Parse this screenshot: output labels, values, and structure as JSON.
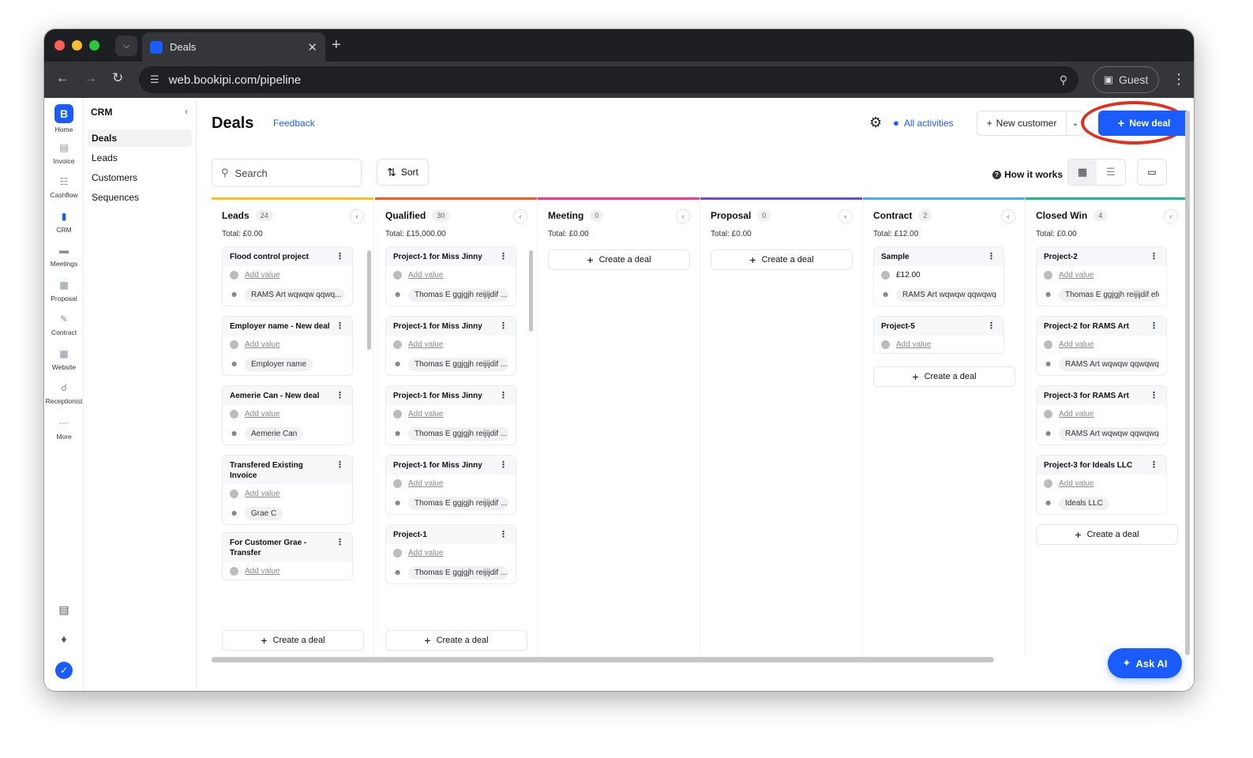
{
  "browser": {
    "tab_title": "Deals",
    "url": "web.bookipi.com/pipeline",
    "profile": "Guest"
  },
  "rail": {
    "logo_letter": "B",
    "items": [
      "Home",
      "Invoice",
      "Cashflow",
      "CRM",
      "Meetings",
      "Proposal",
      "Contract",
      "Website",
      "Receptionist",
      "More"
    ]
  },
  "subnav": {
    "title": "CRM",
    "items": [
      "Deals",
      "Leads",
      "Customers",
      "Sequences"
    ]
  },
  "header": {
    "title": "Deals",
    "feedback": "Feedback",
    "all_activities": "All activities",
    "new_customer": "New customer",
    "new_deal": "New deal"
  },
  "toolbar": {
    "search_placeholder": "Search",
    "sort": "Sort",
    "how_it_works": "How it works"
  },
  "columns": [
    {
      "name": "Leads",
      "count": "24",
      "total": "Total: £0.00",
      "color": "#f2c418",
      "cards": [
        {
          "title": "Flood control project",
          "value": "Add value",
          "person": "RAMS Art wqwqw qqwq..."
        },
        {
          "title": "Employer name - New deal",
          "value": "Add value",
          "person": "Employer name"
        },
        {
          "title": "Aemerie Can - New deal",
          "value": "Add value",
          "person": "Aemerie Can"
        },
        {
          "title": "Transfered Existing Invoice",
          "value": "Add value",
          "person": "Grae C"
        },
        {
          "title": "For Customer Grae - Transfer",
          "value": "Add value",
          "person": ""
        }
      ],
      "create": "Create a deal"
    },
    {
      "name": "Qualified",
      "count": "30",
      "total": "Total: £15,000.00",
      "color": "#ee5c1e",
      "cards": [
        {
          "title": "Project-1 for Miss Jinny",
          "value": "Add value",
          "person": "Thomas E ggjgjh reijijdif ..."
        },
        {
          "title": "Project-1 for Miss Jinny",
          "value": "Add value",
          "person": "Thomas E ggjgjh reijijdif ..."
        },
        {
          "title": "Project-1 for Miss Jinny",
          "value": "Add value",
          "person": "Thomas E ggjgjh reijijdif ..."
        },
        {
          "title": "Project-1 for Miss Jinny",
          "value": "Add value",
          "person": "Thomas E ggjgjh reijijdif ..."
        },
        {
          "title": "Project-1",
          "value": "Add value",
          "person": "Thomas E ggjgjh reijijdif ..."
        }
      ],
      "create": "Create a deal"
    },
    {
      "name": "Meeting",
      "count": "0",
      "total": "Total: £0.00",
      "color": "#e83c8e",
      "cards": [],
      "create": "Create a deal"
    },
    {
      "name": "Proposal",
      "count": "0",
      "total": "Total: £0.00",
      "color": "#6a4cd8",
      "cards": [],
      "create": "Create a deal"
    },
    {
      "name": "Contract",
      "count": "2",
      "total": "Total: £12.00",
      "color": "#56a6ee",
      "cards": [
        {
          "title": "Sample",
          "value": "£12.00",
          "person": "RAMS Art wqwqw qqwqwq ..."
        },
        {
          "title": "Project-5",
          "value": "Add value",
          "person": ""
        }
      ],
      "create": "Create a deal"
    },
    {
      "name": "Closed Win",
      "count": "4",
      "total": "Total: £0.00",
      "color": "#22b884",
      "cards": [
        {
          "title": "Project-2",
          "value": "Add value",
          "person": "Thomas E ggjgjh reijijdif efd..."
        },
        {
          "title": "Project-2 for RAMS Art",
          "value": "Add value",
          "person": "RAMS Art wqwqw qqwqwq ..."
        },
        {
          "title": "Project-3 for RAMS Art",
          "value": "Add value",
          "person": "RAMS Art wqwqw qqwqwq ..."
        },
        {
          "title": "Project-3 for Ideals LLC",
          "value": "Add value",
          "person": "Ideals LLC"
        }
      ],
      "create": "Create a deal"
    }
  ],
  "ask_ai": "Ask AI"
}
